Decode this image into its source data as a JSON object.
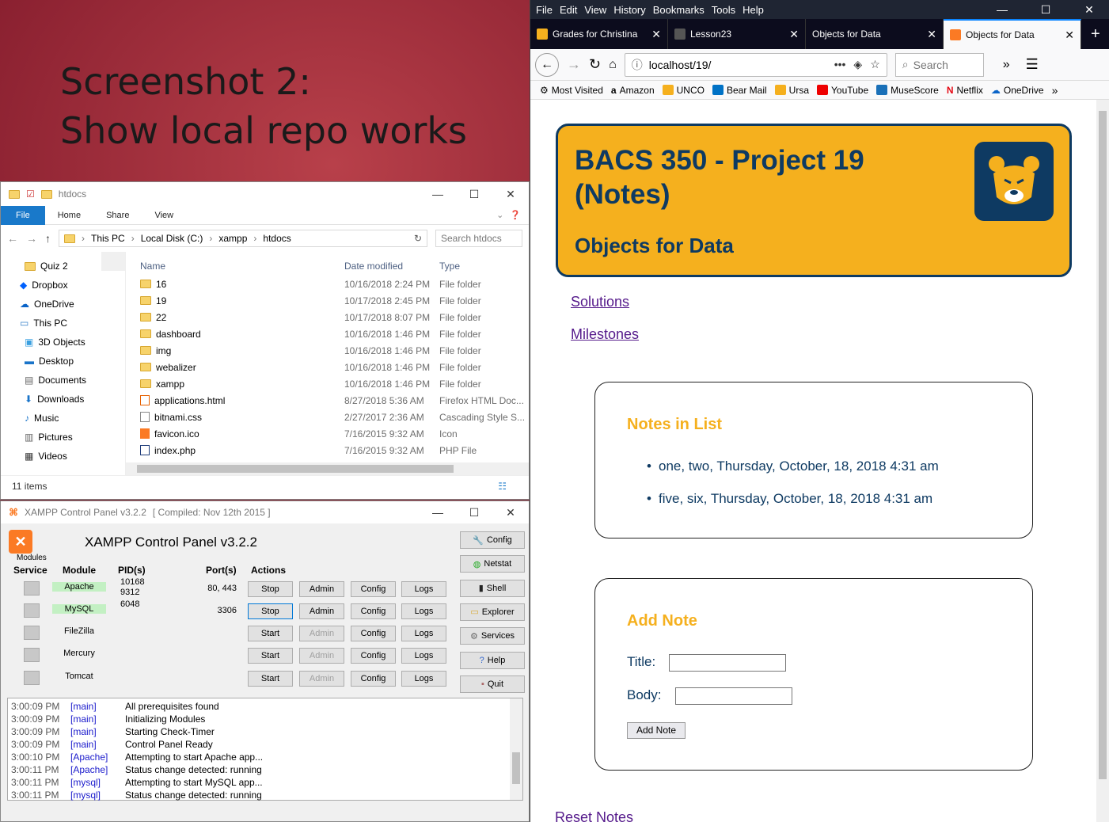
{
  "slide": {
    "line1": "Screenshot 2:",
    "line2": "Show local repo works"
  },
  "explorer": {
    "title": "htdocs",
    "ribbon": [
      "File",
      "Home",
      "Share",
      "View"
    ],
    "path": [
      "This PC",
      "Local Disk (C:)",
      "xampp",
      "htdocs"
    ],
    "search_placeholder": "Search htdocs",
    "tree": [
      {
        "label": "Quiz 2",
        "icon": "folder-icon"
      },
      {
        "label": "Dropbox",
        "icon": "dropbox-icon"
      },
      {
        "label": "OneDrive",
        "icon": "onedrive-icon"
      },
      {
        "label": "This PC",
        "icon": "pc-icon"
      },
      {
        "label": "3D Objects",
        "icon": "3d-objects-icon"
      },
      {
        "label": "Desktop",
        "icon": "desktop-icon"
      },
      {
        "label": "Documents",
        "icon": "documents-icon"
      },
      {
        "label": "Downloads",
        "icon": "downloads-icon"
      },
      {
        "label": "Music",
        "icon": "music-icon"
      },
      {
        "label": "Pictures",
        "icon": "pictures-icon"
      },
      {
        "label": "Videos",
        "icon": "videos-icon"
      }
    ],
    "columns": {
      "name": "Name",
      "date": "Date modified",
      "type": "Type"
    },
    "files": [
      {
        "name": "16",
        "date": "10/16/2018 2:24 PM",
        "type": "File folder",
        "icon": "folder"
      },
      {
        "name": "19",
        "date": "10/17/2018 2:45 PM",
        "type": "File folder",
        "icon": "folder"
      },
      {
        "name": "22",
        "date": "10/17/2018 8:07 PM",
        "type": "File folder",
        "icon": "folder"
      },
      {
        "name": "dashboard",
        "date": "10/16/2018 1:46 PM",
        "type": "File folder",
        "icon": "folder"
      },
      {
        "name": "img",
        "date": "10/16/2018 1:46 PM",
        "type": "File folder",
        "icon": "folder"
      },
      {
        "name": "webalizer",
        "date": "10/16/2018 1:46 PM",
        "type": "File folder",
        "icon": "folder"
      },
      {
        "name": "xampp",
        "date": "10/16/2018 1:46 PM",
        "type": "File folder",
        "icon": "folder"
      },
      {
        "name": "applications.html",
        "date": "8/27/2018 5:36 AM",
        "type": "Firefox HTML Doc...",
        "icon": "html"
      },
      {
        "name": "bitnami.css",
        "date": "2/27/2017 2:36 AM",
        "type": "Cascading Style S...",
        "icon": "css"
      },
      {
        "name": "favicon.ico",
        "date": "7/16/2015 9:32 AM",
        "type": "Icon",
        "icon": "ico"
      },
      {
        "name": "index.php",
        "date": "7/16/2015 9:32 AM",
        "type": "PHP File",
        "icon": "php"
      }
    ],
    "status": "11 items"
  },
  "xampp": {
    "title": "XAMPP Control Panel v3.2.2",
    "compiled": "[ Compiled: Nov 12th 2015 ]",
    "heading": "XAMPP Control Panel v3.2.2",
    "modules_label": "Modules",
    "headers": {
      "service": "Service",
      "module": "Module",
      "pids": "PID(s)",
      "ports": "Port(s)",
      "actions": "Actions"
    },
    "rows": [
      {
        "module": "Apache",
        "pid1": "10168",
        "pid2": "9312",
        "ports": "80, 443",
        "action": "Stop",
        "running": true
      },
      {
        "module": "MySQL",
        "pid1": "6048",
        "pid2": "",
        "ports": "3306",
        "action": "Stop",
        "running": true
      },
      {
        "module": "FileZilla",
        "pid1": "",
        "pid2": "",
        "ports": "",
        "action": "Start",
        "running": false
      },
      {
        "module": "Mercury",
        "pid1": "",
        "pid2": "",
        "ports": "",
        "action": "Start",
        "running": false
      },
      {
        "module": "Tomcat",
        "pid1": "",
        "pid2": "",
        "ports": "",
        "action": "Start",
        "running": false
      }
    ],
    "action_labels": {
      "admin": "Admin",
      "config": "Config",
      "logs": "Logs"
    },
    "side_buttons": [
      "Config",
      "Netstat",
      "Shell",
      "Explorer",
      "Services",
      "Help",
      "Quit"
    ],
    "log": [
      {
        "time": "3:00:09 PM",
        "mod": "[main]",
        "msg": "All prerequisites found"
      },
      {
        "time": "3:00:09 PM",
        "mod": "[main]",
        "msg": "Initializing Modules"
      },
      {
        "time": "3:00:09 PM",
        "mod": "[main]",
        "msg": "Starting Check-Timer"
      },
      {
        "time": "3:00:09 PM",
        "mod": "[main]",
        "msg": "Control Panel Ready"
      },
      {
        "time": "3:00:10 PM",
        "mod": "[Apache]",
        "msg": "Attempting to start Apache app..."
      },
      {
        "time": "3:00:11 PM",
        "mod": "[Apache]",
        "msg": "Status change detected: running"
      },
      {
        "time": "3:00:11 PM",
        "mod": "[mysql]",
        "msg": "Attempting to start MySQL app..."
      },
      {
        "time": "3:00:11 PM",
        "mod": "[mysql]",
        "msg": "Status change detected: running"
      }
    ]
  },
  "firefox": {
    "menu": [
      "File",
      "Edit",
      "View",
      "History",
      "Bookmarks",
      "Tools",
      "Help"
    ],
    "tabs": [
      {
        "label": "Grades for Christina R",
        "color": "#0e3a62"
      },
      {
        "label": "Lesson23",
        "color": "#222"
      },
      {
        "label": "Objects for Data",
        "color": "#0c0c1d"
      },
      {
        "label": "Objects for Data",
        "color": "#fb7a24"
      }
    ],
    "url": "localhost/19/",
    "search_placeholder": "Search",
    "bookmarks": [
      "Most Visited",
      "Amazon",
      "UNCO",
      "Bear Mail",
      "Ursa",
      "YouTube",
      "MuseScore",
      "Netflix",
      "OneDrive"
    ]
  },
  "page": {
    "title": "BACS 350 - Project 19 (Notes)",
    "subtitle": "Objects for Data",
    "links": [
      "Solutions",
      "Milestones"
    ],
    "notes_heading": "Notes in List",
    "notes": [
      "one, two, Thursday, October, 18, 2018 4:31 am",
      "five, six, Thursday, October, 18, 2018 4:31 am"
    ],
    "add_heading": "Add Note",
    "title_label": "Title:",
    "body_label": "Body:",
    "submit": "Add Note",
    "reset_link": "Reset Notes"
  },
  "colors": {
    "accent_gold": "#f5b01e",
    "navy": "#0e3a62",
    "xampp_orange": "#fb7a24",
    "running_green": "#c3f0c3"
  }
}
